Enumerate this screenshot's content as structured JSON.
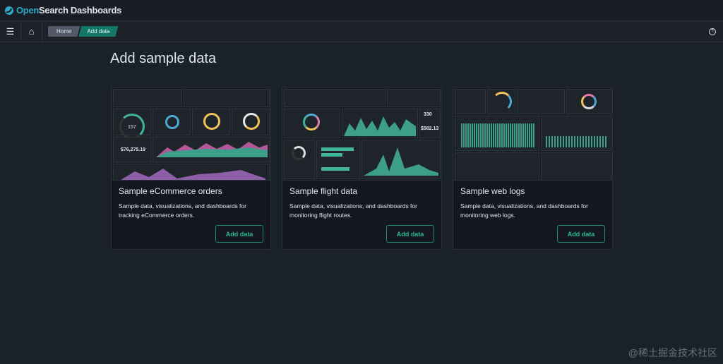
{
  "header": {
    "app_title_open": "Open",
    "app_title_rest": "Search Dashboards"
  },
  "nav": {
    "menu_icon": "hamburger-icon",
    "home_icon": "home-icon",
    "breadcrumbs": [
      "Home",
      "Add data"
    ],
    "help_icon": "help-icon"
  },
  "page": {
    "title": "Add sample data"
  },
  "cards": [
    {
      "title": "Sample eCommerce orders",
      "description": "Sample data, visualizations, and dashboards for tracking eCommerce orders.",
      "button": "Add data",
      "thumb": {
        "metric": "$76,275.19",
        "gauge": "157"
      }
    },
    {
      "title": "Sample flight data",
      "description": "Sample data, visualizations, and dashboards for monitoring flight routes.",
      "button": "Add data",
      "thumb": {
        "metric1": "330",
        "metric2": "$582.13"
      }
    },
    {
      "title": "Sample web logs",
      "description": "Sample data, visualizations, and dashboards for monitoring web logs.",
      "button": "Add data",
      "thumb": {}
    }
  ],
  "colors": {
    "accent": "#137867",
    "button_text": "#2ab79a"
  },
  "watermark": "@稀土掘金技术社区"
}
